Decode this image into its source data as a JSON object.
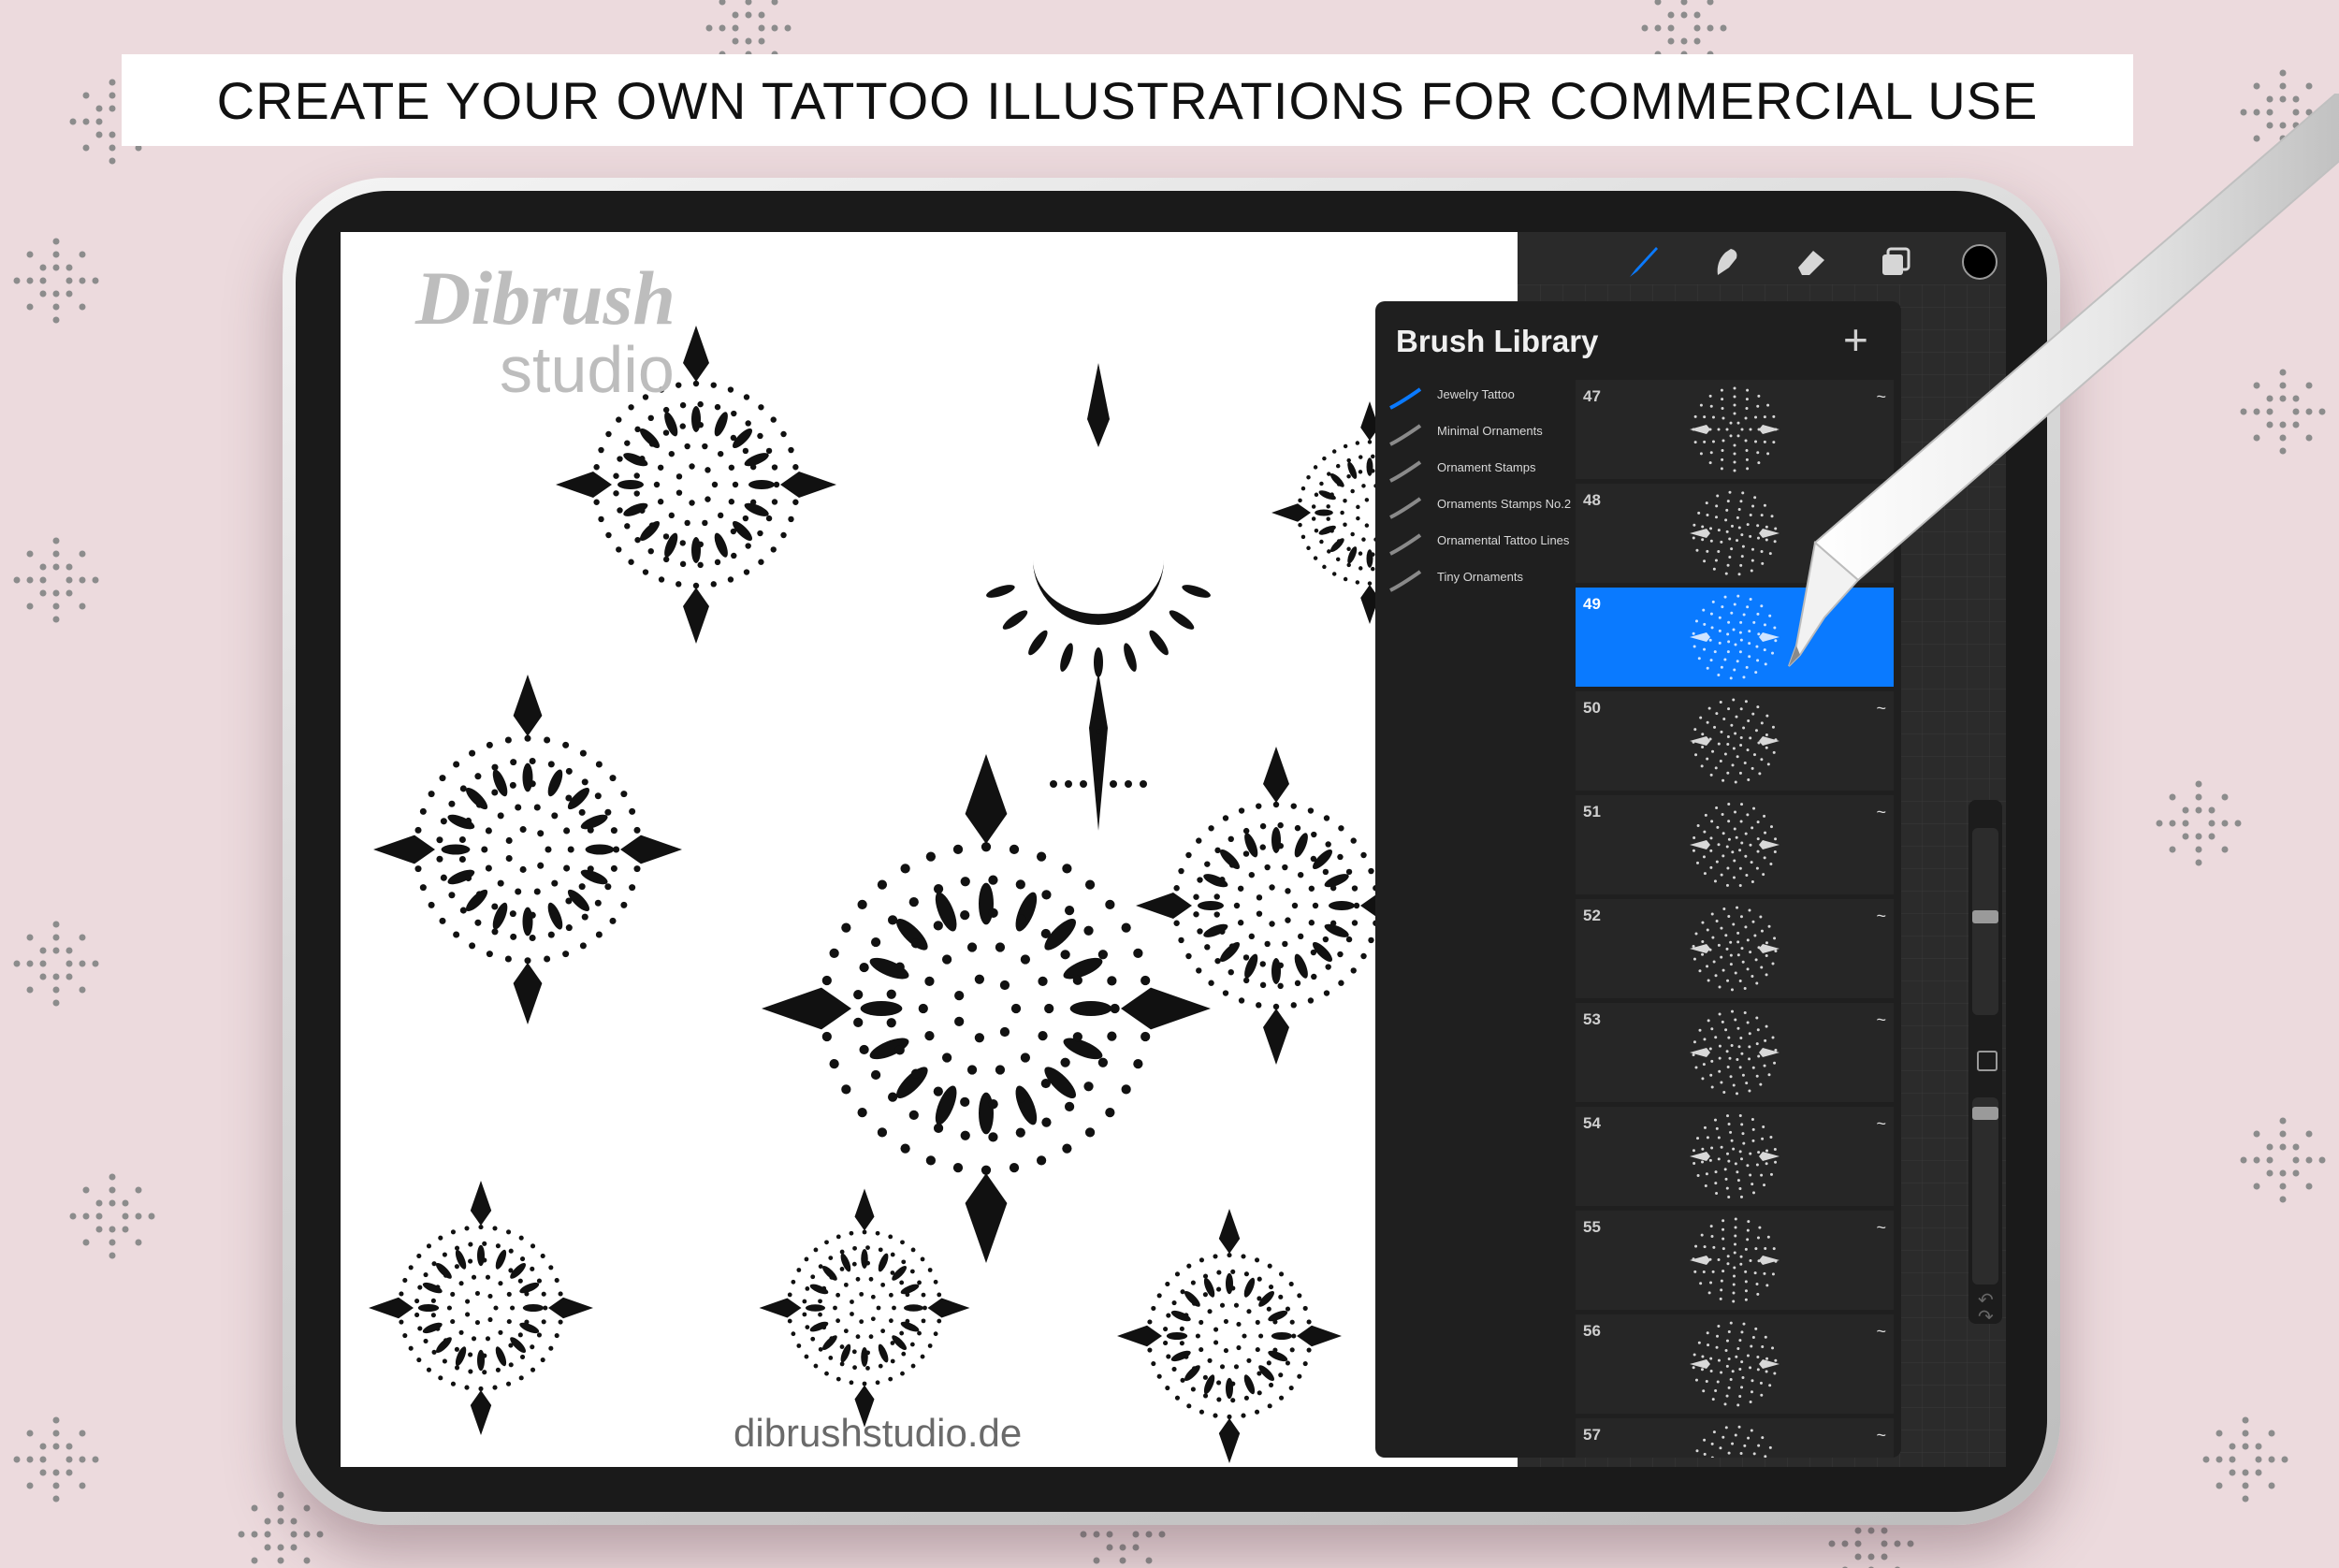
{
  "banner": {
    "text": "CREATE YOUR OWN TATTOO ILLUSTRATIONS FOR COMMERCIAL USE"
  },
  "canvas": {
    "watermark_title": "Dibrush",
    "watermark_subtitle": "studio",
    "website": "dibrushstudio.de"
  },
  "toolbar": {
    "tools": [
      "brush-icon",
      "smudge-icon",
      "eraser-icon",
      "layers-icon",
      "color-icon"
    ],
    "accent": "#0a7aff"
  },
  "brush_library": {
    "title": "Brush Library",
    "add_label": "+",
    "sets": [
      {
        "label": "Jewelry Tattoo",
        "selected": true
      },
      {
        "label": "Minimal Ornaments",
        "selected": false
      },
      {
        "label": "Ornament Stamps",
        "selected": false
      },
      {
        "label": "Ornaments Stamps No.2",
        "selected": false
      },
      {
        "label": "Ornamental Tattoo Lines",
        "selected": false
      },
      {
        "label": "Tiny Ornaments",
        "selected": false
      }
    ],
    "brushes": [
      {
        "number": "47",
        "selected": false
      },
      {
        "number": "48",
        "selected": false
      },
      {
        "number": "49",
        "selected": true
      },
      {
        "number": "50",
        "selected": false
      },
      {
        "number": "51",
        "selected": false
      },
      {
        "number": "52",
        "selected": false
      },
      {
        "number": "53",
        "selected": false
      },
      {
        "number": "54",
        "selected": false
      },
      {
        "number": "55",
        "selected": false
      },
      {
        "number": "56",
        "selected": false
      },
      {
        "number": "57",
        "selected": false
      }
    ]
  },
  "colors": {
    "background": "#ecdadd",
    "selected_brush": "#0a7aff",
    "panel": "#1f1f1f"
  }
}
